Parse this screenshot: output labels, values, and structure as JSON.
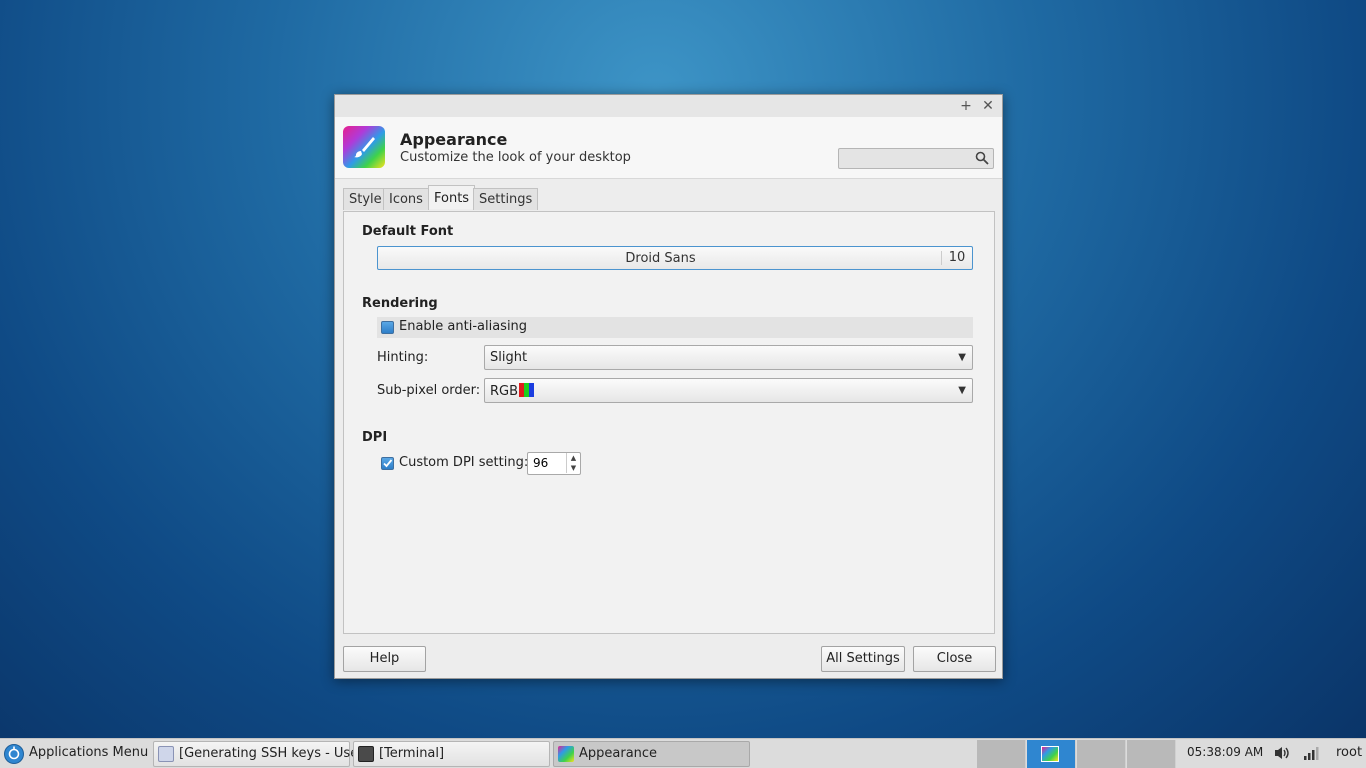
{
  "window": {
    "title_buttons": {
      "maximize": "+",
      "close": "✕"
    },
    "app_icon": "appearance-brush-icon",
    "title": "Appearance",
    "subtitle": "Customize the look of your desktop",
    "search_placeholder": ""
  },
  "tabs": [
    {
      "label": "Style"
    },
    {
      "label": "Icons"
    },
    {
      "label": "Fonts",
      "active": true
    },
    {
      "label": "Settings"
    }
  ],
  "fonts": {
    "default_font_heading": "Default Font",
    "font_name": "Droid Sans",
    "font_size": "10",
    "rendering_heading": "Rendering",
    "antialias_label": "Enable anti-aliasing",
    "antialias_checked": true,
    "hinting_label": "Hinting:",
    "hinting_value": "Slight",
    "subpixel_label": "Sub-pixel order:",
    "subpixel_value": "RGB",
    "subpixel_colors": [
      "#e01b1b",
      "#1bd01b",
      "#1b3de0"
    ],
    "dpi_heading": "DPI",
    "custom_dpi_label": "Custom DPI setting:",
    "custom_dpi_checked": true,
    "dpi_value": "96"
  },
  "buttons": {
    "help": "Help",
    "all_settings": "All Settings",
    "close": "Close"
  },
  "taskbar": {
    "apps_menu": "Applications Menu",
    "tasks": [
      {
        "label": "[Generating SSH keys - User..."
      },
      {
        "label": "[Terminal]"
      },
      {
        "label": "Appearance",
        "active": true
      }
    ],
    "clock": "05:38:09 AM",
    "user": "root"
  },
  "colors": {
    "accent": "#2f86d0",
    "focus_border": "#4b94cf"
  }
}
